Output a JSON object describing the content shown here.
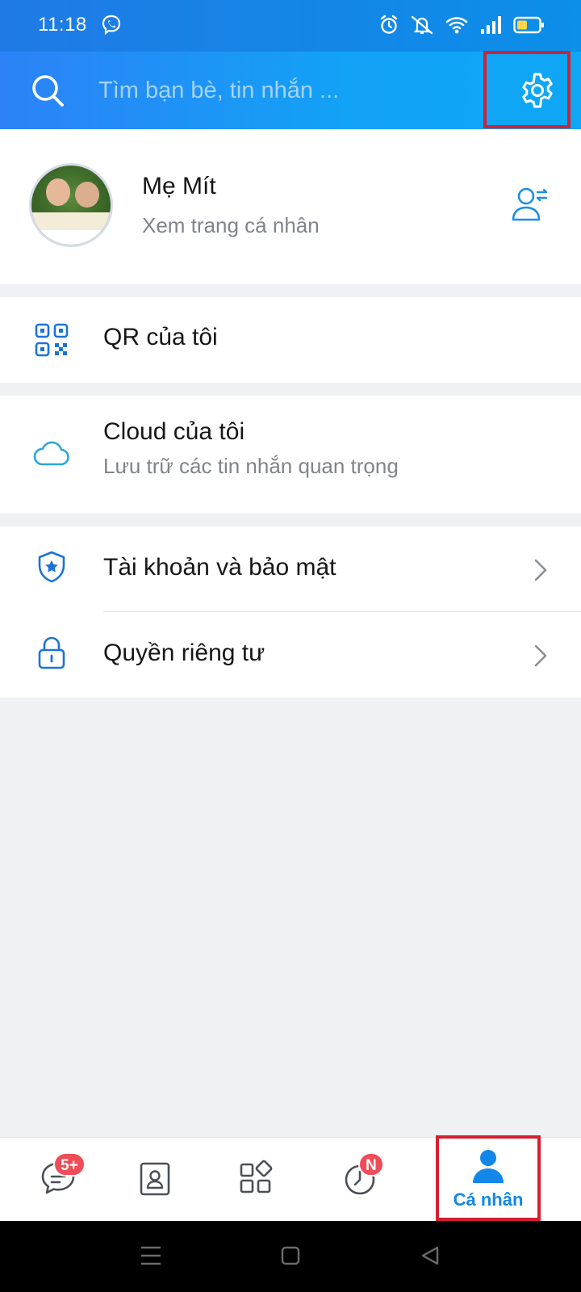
{
  "status_bar": {
    "time": "11:18"
  },
  "search": {
    "placeholder": "Tìm bạn bè, tin nhắn ..."
  },
  "profile": {
    "name": "Mẹ Mít",
    "subtitle": "Xem trang cá nhân"
  },
  "menu": {
    "qr": {
      "title": "QR của tôi"
    },
    "cloud": {
      "title": "Cloud của tôi",
      "subtitle": "Lưu trữ các tin nhắn quan trọng"
    },
    "account": {
      "title": "Tài khoản và bảo mật"
    },
    "privacy": {
      "title": "Quyền riêng tư"
    }
  },
  "bottom_nav": {
    "messages_badge": "5+",
    "timeline_badge": "N",
    "active_label": "Cá nhân",
    "active_tab": "Cá nhân"
  },
  "colors": {
    "accent": "#1287e9",
    "header_start": "#2c82f6",
    "header_end": "#0ea7f5",
    "highlight": "#d32032",
    "badge": "#f04c58"
  },
  "icons": [
    "viber-icon",
    "alarm-icon",
    "mute-icon",
    "wifi-icon",
    "signal-icon",
    "battery-icon",
    "search-icon",
    "gear-icon",
    "switch-account-icon",
    "qr-icon",
    "cloud-icon",
    "shield-icon",
    "lock-icon",
    "chevron-right-icon",
    "chat-icon",
    "contacts-icon",
    "discover-icon",
    "clock-icon",
    "person-icon",
    "menu-icon",
    "home-icon",
    "back-icon"
  ]
}
